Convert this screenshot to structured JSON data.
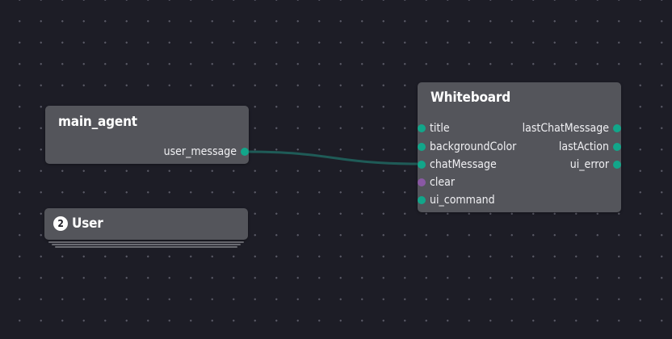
{
  "colors": {
    "port_default": "#12a68a",
    "port_trigger": "#8a58a4",
    "edge": "#1f5b57"
  },
  "nodes": {
    "main_agent": {
      "title": "main_agent",
      "outputs": [
        {
          "label": "user_message"
        }
      ]
    },
    "whiteboard": {
      "title": "Whiteboard",
      "inputs": [
        {
          "label": "title",
          "kind": "default"
        },
        {
          "label": "backgroundColor",
          "kind": "default"
        },
        {
          "label": "chatMessage",
          "kind": "default"
        },
        {
          "label": "clear",
          "kind": "trigger"
        },
        {
          "label": "ui_command",
          "kind": "default"
        }
      ],
      "outputs": [
        {
          "label": "lastChatMessage",
          "kind": "default"
        },
        {
          "label": "lastAction",
          "kind": "default"
        },
        {
          "label": "ui_error",
          "kind": "default"
        }
      ]
    },
    "user_group": {
      "title": "User",
      "count": "2"
    }
  },
  "edges": [
    {
      "from": "main_agent.user_message",
      "to": "whiteboard.chatMessage"
    }
  ]
}
